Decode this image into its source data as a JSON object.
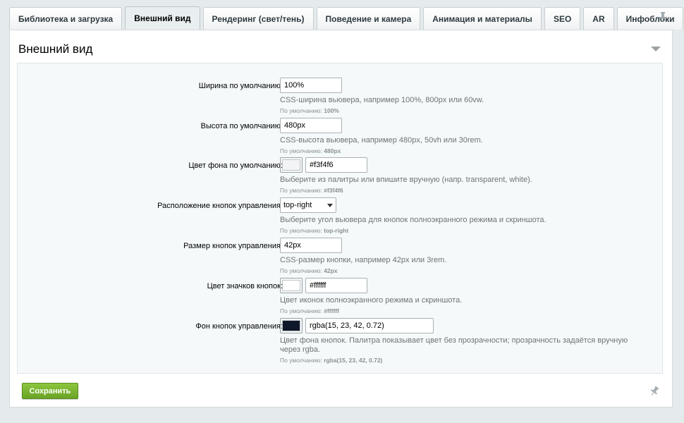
{
  "tabs": [
    {
      "label": "Библиотека и загрузка",
      "active": false
    },
    {
      "label": "Внешний вид",
      "active": true
    },
    {
      "label": "Рендеринг (свет/тень)",
      "active": false
    },
    {
      "label": "Поведение и камера",
      "active": false
    },
    {
      "label": "Анимация и материалы",
      "active": false
    },
    {
      "label": "SEO",
      "active": false
    },
    {
      "label": "AR",
      "active": false
    },
    {
      "label": "Инфоблоки",
      "active": false
    }
  ],
  "panel": {
    "title": "Внешний вид",
    "fields": [
      {
        "label": "Ширина по умолчанию:",
        "value": "100%",
        "hint": "CSS-ширина вьювера, например 100%, 800px или 60vw.",
        "default_prefix": "По умолчанию:",
        "default_value": "100%"
      },
      {
        "label": "Высота по умолчанию:",
        "value": "480px",
        "hint": "CSS-высота вьювера, например 480px, 50vh или 30rem.",
        "default_prefix": "По умолчанию:",
        "default_value": "480px"
      },
      {
        "label": "Цвет фона по умолчанию:",
        "value": "#f3f4f6",
        "swatch_color": "#f3f4f6",
        "hint": "Выберите из палитры или впишите вручную (напр. transparent, white).",
        "default_prefix": "По умолчанию:",
        "default_value": "#f3f4f6"
      },
      {
        "label": "Расположение кнопок управления:",
        "value": "top-right",
        "hint": "Выберите угол вьювера для кнопок полноэкранного режима и скриншота.",
        "default_prefix": "По умолчанию:",
        "default_value": "top-right"
      },
      {
        "label": "Размер кнопок управления:",
        "value": "42px",
        "hint": "CSS-размер кнопки, например 42px или 3rem.",
        "default_prefix": "По умолчанию:",
        "default_value": "42px"
      },
      {
        "label": "Цвет значков кнопок:",
        "value": "#ffffff",
        "swatch_color": "#ffffff",
        "hint": "Цвет иконок полноэкранного режима и скриншота.",
        "default_prefix": "По умолчанию:",
        "default_value": "#ffffff"
      },
      {
        "label": "Фон кнопок управления:",
        "value": "rgba(15, 23, 42, 0.72)",
        "swatch_color": "#0f172a",
        "hint": "Цвет фона кнопок. Палитра показывает цвет без прозрачности; прозрачность задаётся вручную через rgba.",
        "default_prefix": "По умолчанию:",
        "default_value": "rgba(15, 23, 42, 0.72)"
      }
    ],
    "save_label": "Сохранить"
  },
  "icons": {
    "pin": "pin-icon",
    "collapse": "chevron-down-icon"
  },
  "colors": {
    "save_button": "#7ab52f",
    "background": "#e5eaec"
  }
}
